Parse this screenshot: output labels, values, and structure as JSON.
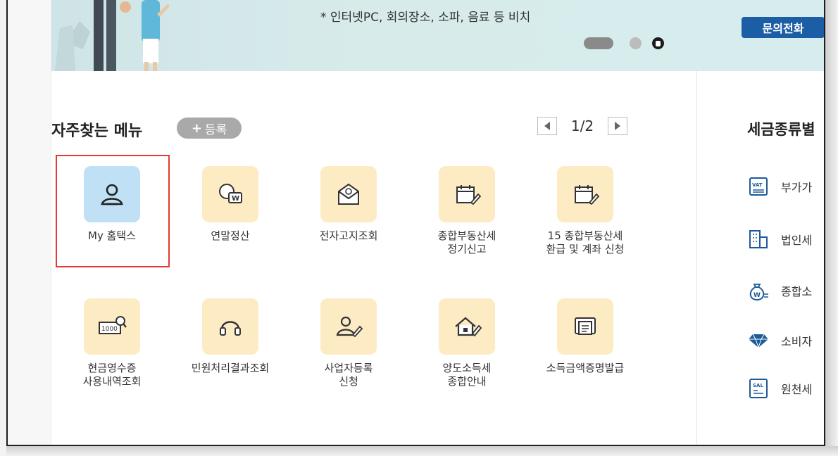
{
  "banner": {
    "notice": "* 인터넷PC, 회의장소, 소파, 음료 등 비치",
    "contact_button": "문의전화"
  },
  "favorites": {
    "title": "자주찾는 메뉴",
    "register_label": "등록",
    "pager": "1/2",
    "items": [
      {
        "label": "My 홈택스",
        "icon": "person-icon",
        "highlighted": true
      },
      {
        "label": "연말정산",
        "icon": "coin-icon"
      },
      {
        "label": "전자고지조회",
        "icon": "mail-icon"
      },
      {
        "label": "종합부동산세\n정기신고",
        "icon": "calendar-pen-icon"
      },
      {
        "label": "15 종합부동산세\n환급 및 계좌 신청",
        "icon": "calendar-pen-icon"
      },
      {
        "label": "현금영수증\n사용내역조회",
        "icon": "receipt-search-icon"
      },
      {
        "label": "민원처리결과조회",
        "icon": "headset-icon"
      },
      {
        "label": "사업자등록\n신청",
        "icon": "person-pen-icon"
      },
      {
        "label": "양도소득세\n종합안내",
        "icon": "house-pen-icon"
      },
      {
        "label": "소득금액증명발급",
        "icon": "document-icon"
      }
    ]
  },
  "tax_types": {
    "title": "세금종류별",
    "items": [
      {
        "label": "부가가",
        "icon": "vat-icon"
      },
      {
        "label": "법인세",
        "icon": "building-icon"
      },
      {
        "label": "종합소",
        "icon": "money-bag-icon"
      },
      {
        "label": "소비자",
        "icon": "diamond-icon"
      },
      {
        "label": "원천세",
        "icon": "sal-doc-icon"
      }
    ]
  },
  "colors": {
    "accent_blue": "#1b5ea6",
    "highlight_red": "#e53935",
    "icon_bg_yellow": "#fdebc4",
    "icon_bg_blue": "#bfe0f5"
  }
}
